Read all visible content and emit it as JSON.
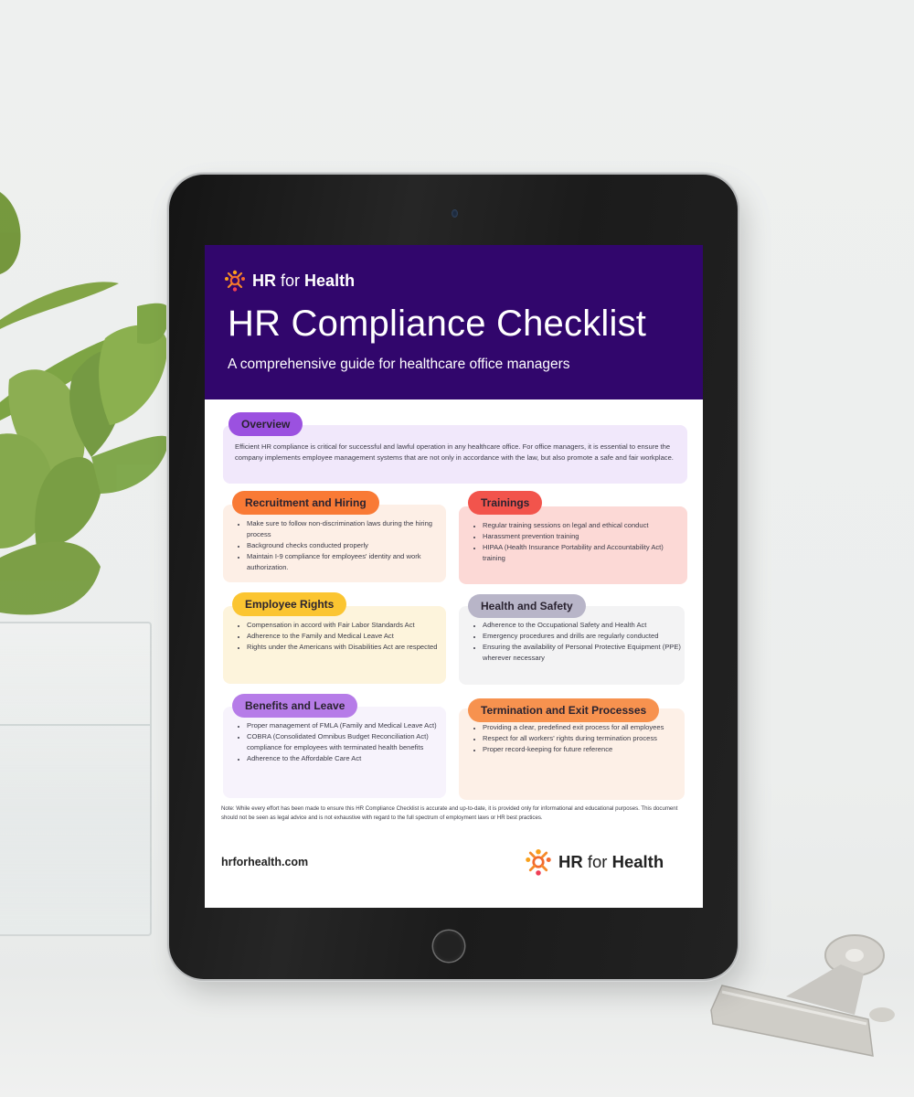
{
  "document": {
    "brand": {
      "name_bold_1": "HR",
      "name_light": "for",
      "name_bold_2": "Health",
      "logo_icon": "sunburst-people-logo-icon",
      "logo_colors": [
        "#f9a01b",
        "#f26a2e",
        "#ef3e55"
      ]
    },
    "header": {
      "title": "HR Compliance Checklist",
      "subtitle": "A comprehensive guide for healthcare office managers",
      "background": "#31066c"
    },
    "overview": {
      "label": "Overview",
      "text": "Efficient HR compliance is critical for successful and lawful operation in any healthcare office. For office managers, it is essential to ensure the company implements employee management systems that are not only in accordance with the law, but also promote a safe and fair workplace.",
      "pill_color": "#9b51e0",
      "card_color": "#f1e8fb"
    },
    "sections": [
      {
        "label": "Recruitment and Hiring",
        "pill_color": "#f97a35",
        "card_color": "#fdefe6",
        "items": [
          "Make sure to follow non-discrimination laws during the hiring process",
          "Background checks conducted properly",
          "Maintain I-9 compliance for employees' identity and work authorization."
        ]
      },
      {
        "label": "Trainings",
        "pill_color": "#f2544c",
        "card_color": "#fcd9d6",
        "items": [
          "Regular training sessions on legal and ethical conduct",
          "Harassment prevention training",
          "HIPAA (Health Insurance Portability and Accountability Act) training"
        ]
      },
      {
        "label": "Employee Rights",
        "pill_color": "#fbc531",
        "card_color": "#fdf4dc",
        "items": [
          "Compensation in accord with Fair Labor Standards Act",
          "Adherence to the Family and Medical Leave Act",
          "Rights under the Americans with Disabilities Act are respected"
        ]
      },
      {
        "label": "Health and Safety",
        "pill_color": "#b8b5c8",
        "card_color": "#f3f3f4",
        "items": [
          "Adherence to the Occupational Safety and Health Act",
          "Emergency procedures and drills are regularly conducted",
          "Ensuring the availability of Personal Protective Equipment (PPE) wherever necessary"
        ]
      },
      {
        "label": "Benefits and Leave",
        "pill_color": "#b67ce8",
        "card_color": "#f7f3fc",
        "items": [
          "Proper management of FMLA (Family and Medical Leave Act)",
          "COBRA (Consolidated Omnibus Budget Reconciliation Act) compliance for employees with terminated health benefits",
          "Adherence to the Affordable Care Act"
        ]
      },
      {
        "label": "Termination and Exit Processes",
        "pill_color": "#f7924f",
        "card_color": "#fdf0e7",
        "items": [
          "Providing a clear, predefined exit process for all employees",
          "Respect for all workers' rights during termination process",
          "Proper record-keeping for future reference"
        ]
      }
    ],
    "note": "Note: While every effort has been made to ensure this HR Compliance Checklist is accurate and up-to-date, it is provided only for informational and educational purposes. This document should not be seen as legal advice and is not exhaustive with regard to the full spectrum of employment laws or HR best practices.",
    "footer": {
      "website": "hrforhealth.com"
    }
  },
  "scene": {
    "device": "tablet",
    "props": [
      "potted-plant-in-glass",
      "binder-clip"
    ]
  }
}
